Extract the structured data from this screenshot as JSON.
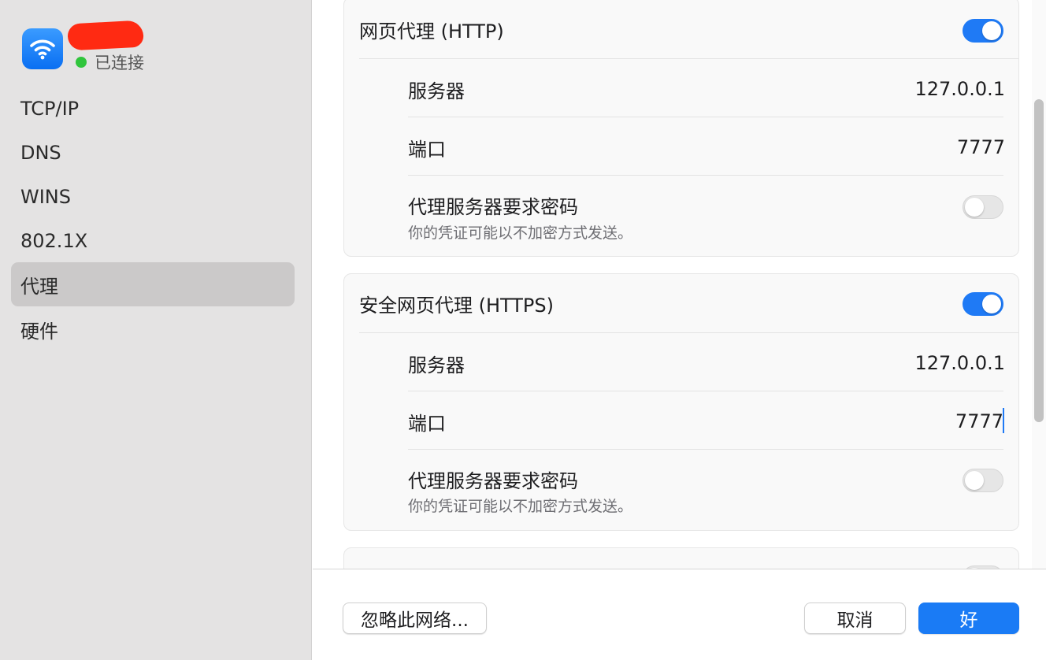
{
  "sidebar": {
    "network_icon": "wifi-icon",
    "status": "已连接",
    "status_color": "#30c53c",
    "items": [
      {
        "label": "TCP/IP"
      },
      {
        "label": "DNS"
      },
      {
        "label": "WINS"
      },
      {
        "label": "802.1X"
      },
      {
        "label": "代理"
      },
      {
        "label": "硬件"
      }
    ],
    "selected": "代理"
  },
  "main": {
    "http_proxy": {
      "title": "网页代理 (HTTP)",
      "enabled": true,
      "server_label": "服务器",
      "server_value": "127.0.0.1",
      "port_label": "端口",
      "port_value": "7777",
      "auth_label": "代理服务器要求密码",
      "auth_note": "你的凭证可能以不加密方式发送。",
      "auth_enabled": false
    },
    "https_proxy": {
      "title": "安全网页代理 (HTTPS)",
      "enabled": true,
      "server_label": "服务器",
      "server_value": "127.0.0.1",
      "port_label": "端口",
      "port_value": "7777",
      "auth_label": "代理服务器要求密码",
      "auth_note": "你的凭证可能以不加密方式发送。",
      "auth_enabled": false
    },
    "accent_color": "#1f7af5"
  },
  "footer": {
    "forget_label": "忽略此网络...",
    "cancel_label": "取消",
    "ok_label": "好"
  }
}
